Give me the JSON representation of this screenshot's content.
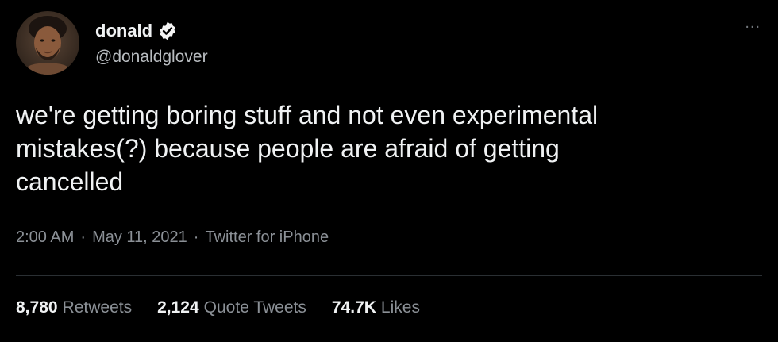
{
  "author": {
    "display_name": "donald",
    "handle": "@donaldglover",
    "avatar_icon": "profile-photo",
    "verified_icon": "verified-badge-icon"
  },
  "header": {
    "more_label": "..."
  },
  "tweet": {
    "text": "we're getting boring stuff and not even experimental\nmistakes(?) because people are afraid of getting\ncancelled"
  },
  "meta": {
    "time": "2:00 AM",
    "separator": "·",
    "date": "May 11, 2021",
    "source": "Twitter for iPhone"
  },
  "stats": {
    "retweets": {
      "count": "8,780",
      "label": "Retweets"
    },
    "quote_tweets": {
      "count": "2,124",
      "label": "Quote Tweets"
    },
    "likes": {
      "count": "74.7K",
      "label": "Likes"
    }
  },
  "colors": {
    "background": "#000000",
    "text_primary": "#f0f2f3",
    "text_secondary": "#8b9096",
    "divider": "#2a2f33"
  }
}
